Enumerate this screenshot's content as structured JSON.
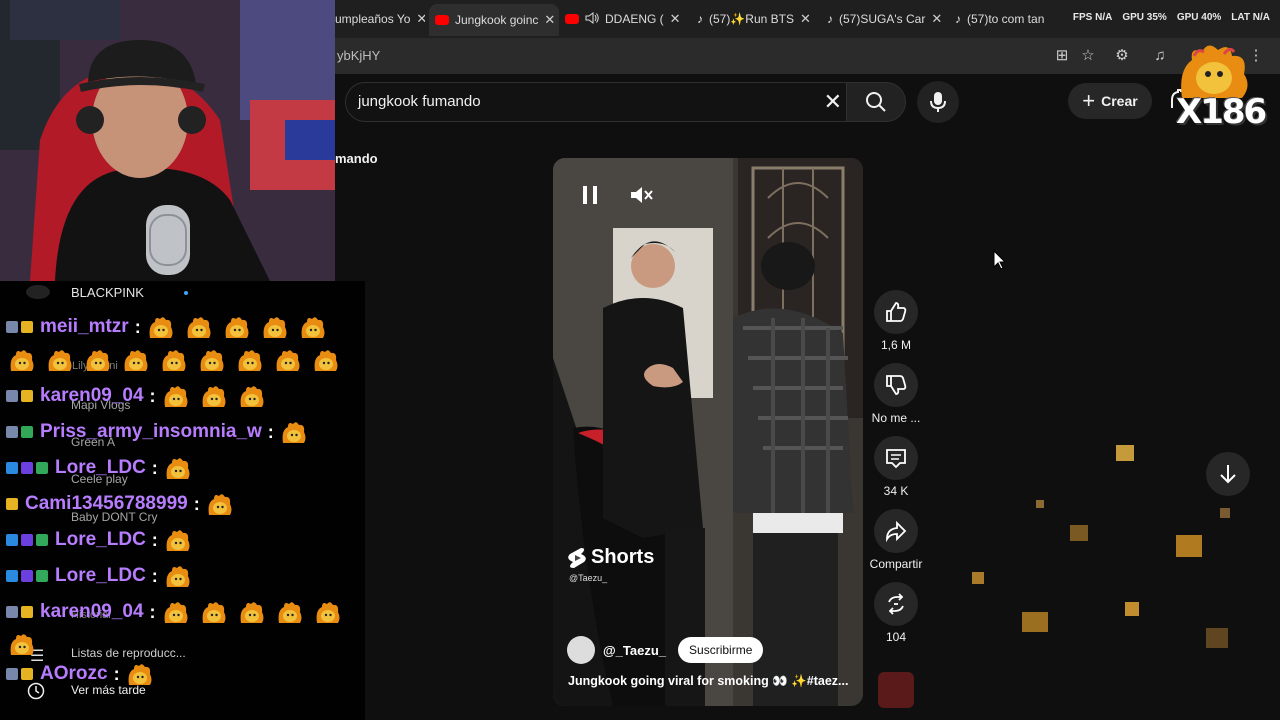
{
  "browser": {
    "tabs": [
      {
        "label": "umpleaños Yo",
        "icon": "none"
      },
      {
        "label": "Jungkook goinc",
        "icon": "youtube-icon",
        "active": true
      },
      {
        "label": "DDAENG (",
        "icon": "youtube-icon",
        "muted": true
      },
      {
        "label": "(57)✨Run BTS",
        "icon": "tiktok-icon"
      },
      {
        "label": "(57)SUGA's Car",
        "icon": "tiktok-icon"
      },
      {
        "label": "(57)to com tan",
        "icon": "tiktok-icon"
      }
    ],
    "url_fragment": "ybKjHY",
    "stats": [
      "FPS N/A",
      "GPU 35%",
      "GPU 40%",
      "LAT N/A"
    ]
  },
  "youtube": {
    "search": {
      "query": "jungkook fumando"
    },
    "create_label": "Crear",
    "partial_title": "mando",
    "short": {
      "shorts_label": "Shorts",
      "shorts_handle": "@Taezu_",
      "channel": "@_Taezu_",
      "subscribe_label": "Suscribirme",
      "title": "Jungkook going viral for smoking 👀 ✨#taez..."
    },
    "actions": {
      "likes": "1,6 M",
      "dislike_label": "No me ...",
      "comments": "34 K",
      "share_label": "Compartir",
      "remix_count": "104"
    }
  },
  "sidebar_ghost": {
    "items": [
      "BLACKPINK",
      "Lily Jenni",
      "Mapi Vlogs",
      "Green A",
      "Ceele play",
      "Baby DONT Cry",
      "Historial",
      "Listas de reproducc...",
      "Ver más tarde"
    ]
  },
  "overlay": {
    "counter": "X186"
  },
  "chat": {
    "messages": [
      {
        "user": "meii_mtzr",
        "emotes": 5
      },
      {
        "user": "",
        "emotes": 9
      },
      {
        "user": "karen09_04",
        "emotes": 3
      },
      {
        "user": "Priss_army_insomnia_w",
        "emotes": 1
      },
      {
        "user": "Lore_LDC",
        "emotes": 1
      },
      {
        "user": "Cami13456788999",
        "emotes": 1
      },
      {
        "user": "Lore_LDC",
        "emotes": 1
      },
      {
        "user": "Lore_LDC",
        "emotes": 1
      },
      {
        "user": "karen09_04",
        "emotes": 5
      },
      {
        "user": "",
        "emotes": 1
      },
      {
        "user": "AOrozc",
        "emotes": 1
      }
    ]
  },
  "colors": {
    "username": "#b87dff",
    "youtube_red": "#ff0000",
    "bg": "#0f0f0f"
  }
}
